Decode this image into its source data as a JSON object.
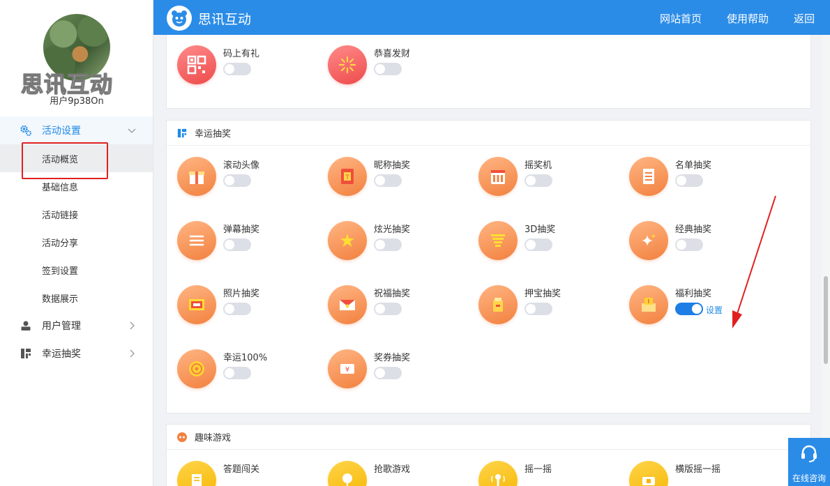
{
  "sidebar": {
    "brand_text": "思讯互动",
    "username": "用户9p38On",
    "menu": {
      "activity_settings": "活动设置",
      "sub": [
        "活动概览",
        "基础信息",
        "活动链接",
        "活动分享",
        "签到设置",
        "数据展示"
      ],
      "user_management": "用户管理",
      "lucky_draw": "幸运抽奖"
    }
  },
  "header": {
    "title": "思讯互动",
    "nav": [
      "网站首页",
      "使用帮助",
      "返回"
    ]
  },
  "sections": {
    "top": {
      "items": [
        {
          "label": "码上有礼",
          "enabled": false,
          "icon": "qrcode-icon"
        },
        {
          "label": "恭喜发财",
          "enabled": false,
          "icon": "firework-icon"
        }
      ]
    },
    "lucky": {
      "title": "幸运抽奖",
      "items": [
        {
          "label": "滚动头像",
          "enabled": false,
          "icon": "gift-box-icon"
        },
        {
          "label": "昵称抽奖",
          "enabled": false,
          "icon": "nickname-card-icon"
        },
        {
          "label": "摇奖机",
          "enabled": false,
          "icon": "slot-machine-icon"
        },
        {
          "label": "名单抽奖",
          "enabled": false,
          "icon": "list-icon"
        },
        {
          "label": "弹幕抽奖",
          "enabled": false,
          "icon": "danmaku-icon"
        },
        {
          "label": "炫光抽奖",
          "enabled": false,
          "icon": "sparkle-star-icon"
        },
        {
          "label": "3D抽奖",
          "enabled": false,
          "icon": "3d-stack-icon"
        },
        {
          "label": "经典抽奖",
          "enabled": false,
          "icon": "twinkle-icon"
        },
        {
          "label": "照片抽奖",
          "enabled": false,
          "icon": "photo-icon"
        },
        {
          "label": "祝福抽奖",
          "enabled": false,
          "icon": "envelope-icon"
        },
        {
          "label": "押宝抽奖",
          "enabled": false,
          "icon": "treasure-bag-icon"
        },
        {
          "label": "福利抽奖",
          "enabled": true,
          "icon": "welfare-box-icon",
          "action": "设置"
        },
        {
          "label": "幸运100%",
          "enabled": false,
          "icon": "coin-icon"
        },
        {
          "label": "奖券抽奖",
          "enabled": false,
          "icon": "ticket-icon"
        }
      ]
    },
    "games": {
      "title": "趣味游戏",
      "items": [
        {
          "label": "答题闯关",
          "icon": "quiz-icon"
        },
        {
          "label": "抢歌游戏",
          "icon": "music-icon"
        },
        {
          "label": "摇一摇",
          "icon": "shake-icon"
        },
        {
          "label": "横版摇一摇",
          "icon": "phone-shake-icon"
        }
      ]
    }
  },
  "float_button": {
    "label": "在线咨询"
  },
  "colors": {
    "primary": "#2b8ce8",
    "toggle_on": "#1e7ee6",
    "orange": "#f2813f",
    "red": "#ee4b4b",
    "yellow": "#f5b600",
    "annotation": "#e02020"
  }
}
